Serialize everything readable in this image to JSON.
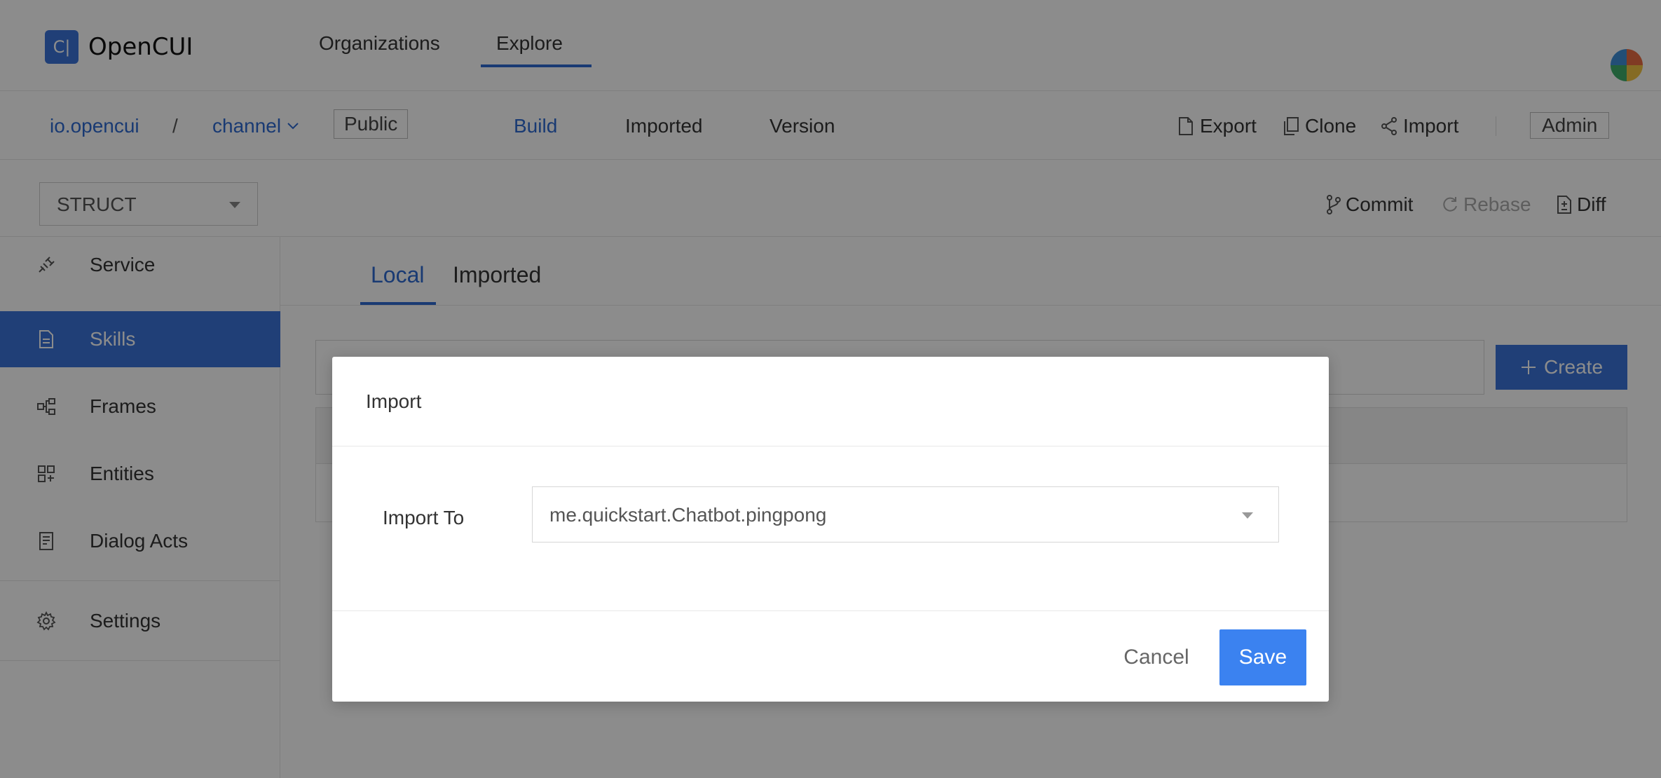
{
  "app": {
    "logo_mark": "C|",
    "name": "OpenCUI"
  },
  "topnav": {
    "items": [
      {
        "label": "Organizations"
      },
      {
        "label": "Explore"
      }
    ]
  },
  "project": {
    "org": "io.opencui",
    "separator": "/",
    "name": "channel",
    "visibility": "Public",
    "tabs": [
      {
        "label": "Build",
        "active": true
      },
      {
        "label": "Imported"
      },
      {
        "label": "Version"
      }
    ],
    "actions": {
      "export": "Export",
      "clone": "Clone",
      "import": "Import",
      "role": "Admin"
    }
  },
  "toolbar": {
    "type_select": "STRUCT",
    "commit": "Commit",
    "rebase": "Rebase",
    "diff": "Diff"
  },
  "sidebar": {
    "items": [
      {
        "label": "Service",
        "icon": "plug-icon"
      },
      {
        "label": "Skills",
        "icon": "document-icon",
        "active": true
      },
      {
        "label": "Frames",
        "icon": "frames-icon"
      },
      {
        "label": "Entities",
        "icon": "entities-icon"
      },
      {
        "label": "Dialog Acts",
        "icon": "dialog-acts-icon"
      },
      {
        "label": "Settings",
        "icon": "gear-icon"
      }
    ]
  },
  "main": {
    "tabs": [
      {
        "label": "Local",
        "active": true
      },
      {
        "label": "Imported"
      }
    ],
    "create_label": "Create"
  },
  "modal": {
    "title": "Import",
    "field_label": "Import To",
    "field_value": "me.quickstart.Chatbot.pingpong",
    "cancel_label": "Cancel",
    "save_label": "Save"
  },
  "colors": {
    "accent": "#3b74d9",
    "link": "#2f6bd1",
    "save": "#3b82f0"
  }
}
